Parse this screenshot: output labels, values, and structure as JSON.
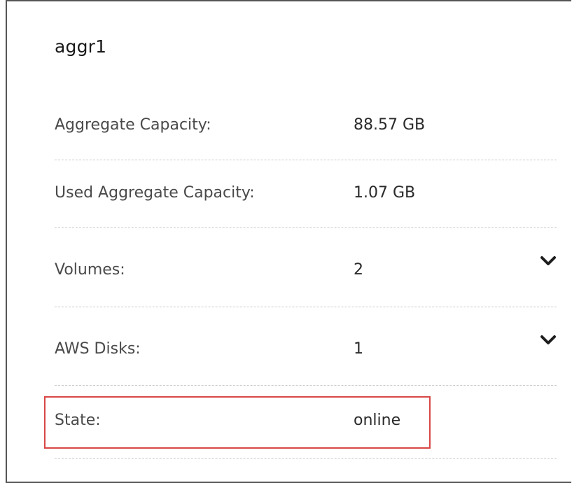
{
  "panel": {
    "title": "aggr1"
  },
  "rows": [
    {
      "label": "Aggregate Capacity:",
      "value": "88.57 GB",
      "expandable": false
    },
    {
      "label": "Used Aggregate Capacity:",
      "value": "1.07 GB",
      "expandable": false
    },
    {
      "label": "Volumes:",
      "value": "2",
      "expandable": true,
      "icon": "chevron-down-icon"
    },
    {
      "label": "AWS Disks:",
      "value": "1",
      "expandable": true,
      "icon": "chevron-down-icon"
    },
    {
      "label": "State:",
      "value": "online",
      "expandable": false,
      "highlighted": true
    }
  ],
  "colors": {
    "highlight_border": "#d94646",
    "label_text": "#4a4a4a",
    "divider": "#c8c8c8"
  }
}
